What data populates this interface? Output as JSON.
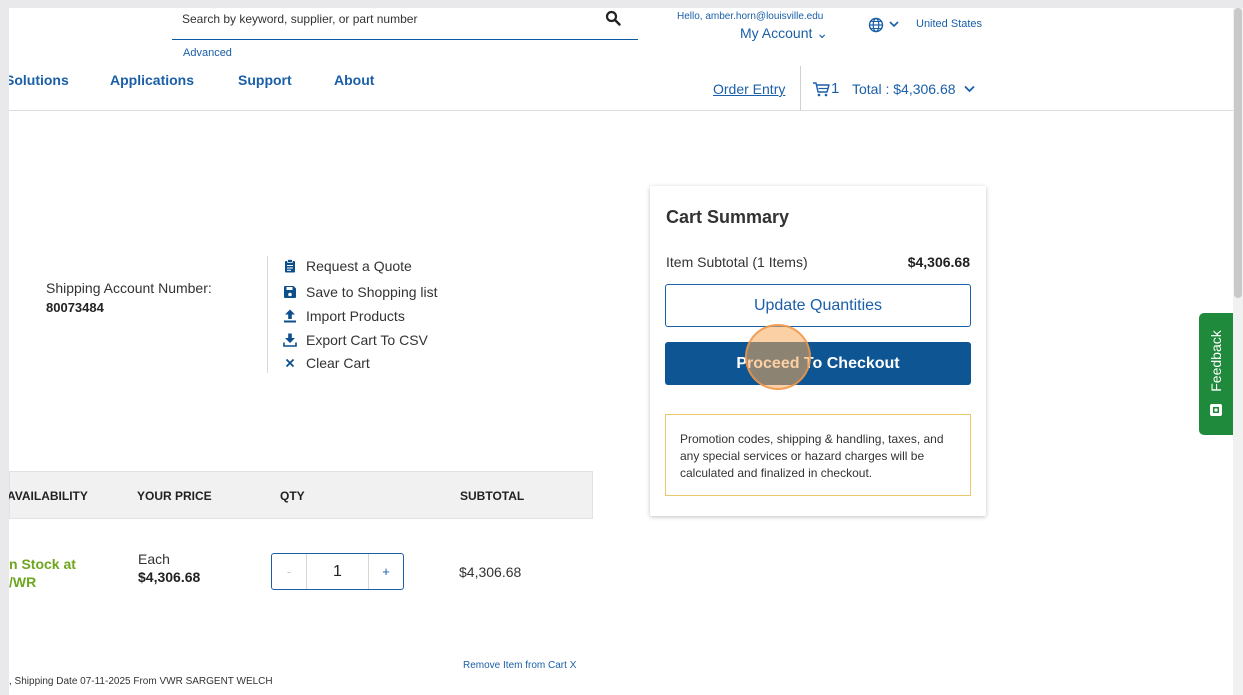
{
  "header": {
    "search_placeholder": "Search by keyword, supplier, or part number",
    "advanced_label": "Advanced",
    "greeting": "Hello, amber.horn@louisville.edu",
    "account_label": "My Account ⌄",
    "country": "United States"
  },
  "nav": {
    "items": [
      "Solutions",
      "Applications",
      "Support",
      "About"
    ],
    "order_entry": "Order Entry",
    "cart_count": "1",
    "cart_total": "Total : $4,306.68"
  },
  "account": {
    "label": "Shipping Account Number:",
    "number": "80073484"
  },
  "actions": [
    {
      "label": "Request a Quote",
      "icon": "clipboard-icon"
    },
    {
      "label": "Save to Shopping list",
      "icon": "save-icon"
    },
    {
      "label": "Import Products",
      "icon": "upload-icon"
    },
    {
      "label": "Export Cart To CSV",
      "icon": "download-icon"
    },
    {
      "label": "Clear Cart",
      "icon": "close-icon"
    }
  ],
  "table": {
    "headers": [
      "AVAILABILITY",
      "YOUR PRICE",
      "QTY",
      "SUBTOTAL"
    ],
    "row": {
      "availability_line1": "n Stock at",
      "availability_line2": "/WR",
      "unit": "Each",
      "price": "$4,306.68",
      "qty_minus": "-",
      "qty": "1",
      "qty_plus": "+",
      "subtotal": "$4,306.68",
      "remove": "Remove Item from Cart X",
      "shipping": ", Shipping Date 07-11-2025 From VWR SARGENT WELCH"
    }
  },
  "summary": {
    "title": "Cart Summary",
    "subtotal_label": "Item Subtotal (1 Items)",
    "subtotal_value": "$4,306.68",
    "update_label": "Update Quantities",
    "checkout_label": "Proceed To Checkout",
    "promo_text": "Promotion codes, shipping & handling, taxes, and any special services or hazard charges will be calculated and finalized in checkout."
  },
  "feedback": {
    "label": "Feedback"
  },
  "colors": {
    "brand_blue": "#0d5593",
    "link_blue": "#1a5fa8",
    "stock_green": "#6ea61f",
    "feedback_green": "#1f8a3b"
  }
}
